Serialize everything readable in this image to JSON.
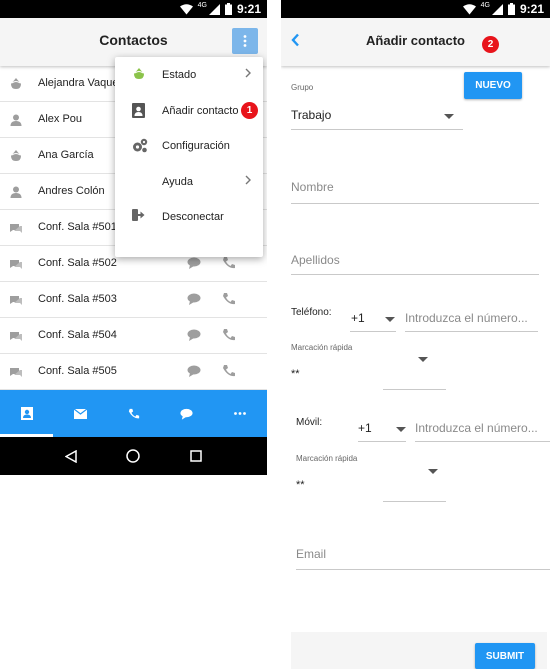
{
  "status_bar": {
    "network": "4G",
    "time": "9:21"
  },
  "contacts_screen": {
    "title": "Contactos",
    "contacts": [
      {
        "name": "Alejandra Vaque",
        "icon": "status-icon"
      },
      {
        "name": "Alex Pou",
        "icon": "person-icon"
      },
      {
        "name": "Ana García",
        "icon": "status-icon"
      },
      {
        "name": "Andres Colón",
        "icon": "person-icon"
      },
      {
        "name": "Conf. Sala #501",
        "icon": "chat-icon"
      },
      {
        "name": "Conf. Sala #502",
        "icon": "chat-icon"
      },
      {
        "name": "Conf. Sala #503",
        "icon": "chat-icon"
      },
      {
        "name": "Conf. Sala #504",
        "icon": "chat-icon"
      },
      {
        "name": "Conf. Sala #505",
        "icon": "chat-icon"
      }
    ],
    "menu": [
      {
        "label": "Estado",
        "icon": "status-dot-icon",
        "has_arrow": true
      },
      {
        "label": "Añadir contacto",
        "icon": "add-contact-icon",
        "has_arrow": false,
        "badge": "1"
      },
      {
        "label": "Configuración",
        "icon": "gears-icon",
        "has_arrow": false
      },
      {
        "label": "Ayuda",
        "icon": "",
        "has_arrow": true
      },
      {
        "label": "Desconectar",
        "icon": "logout-icon",
        "has_arrow": false
      }
    ],
    "bottom_tabs": [
      "contacts-icon",
      "mail-icon",
      "phone-icon",
      "chat-icon",
      "more-icon"
    ],
    "accent_color": "#2196f3",
    "status_color": "#8bc34a"
  },
  "add_contact_screen": {
    "title": "Añadir contacto",
    "badge": "2",
    "group_label": "Grupo",
    "group_value": "Trabajo",
    "new_button": "NUEVO",
    "name_placeholder": "Nombre",
    "surname_placeholder": "Apellidos",
    "phone_label": "Teléfono:",
    "phone_code": "+1",
    "phone_placeholder": "Introduzca el número...",
    "speed_dial_label_1": "Marcación rápida",
    "speed_dial_value_1": "**",
    "mobile_label": "Móvil:",
    "mobile_code": "+1",
    "mobile_placeholder": "Introduzca el número...",
    "speed_dial_label_2": "Marcación rápida",
    "speed_dial_value_2": "**",
    "email_placeholder": "Email",
    "submit_button": "SUBMIT"
  }
}
